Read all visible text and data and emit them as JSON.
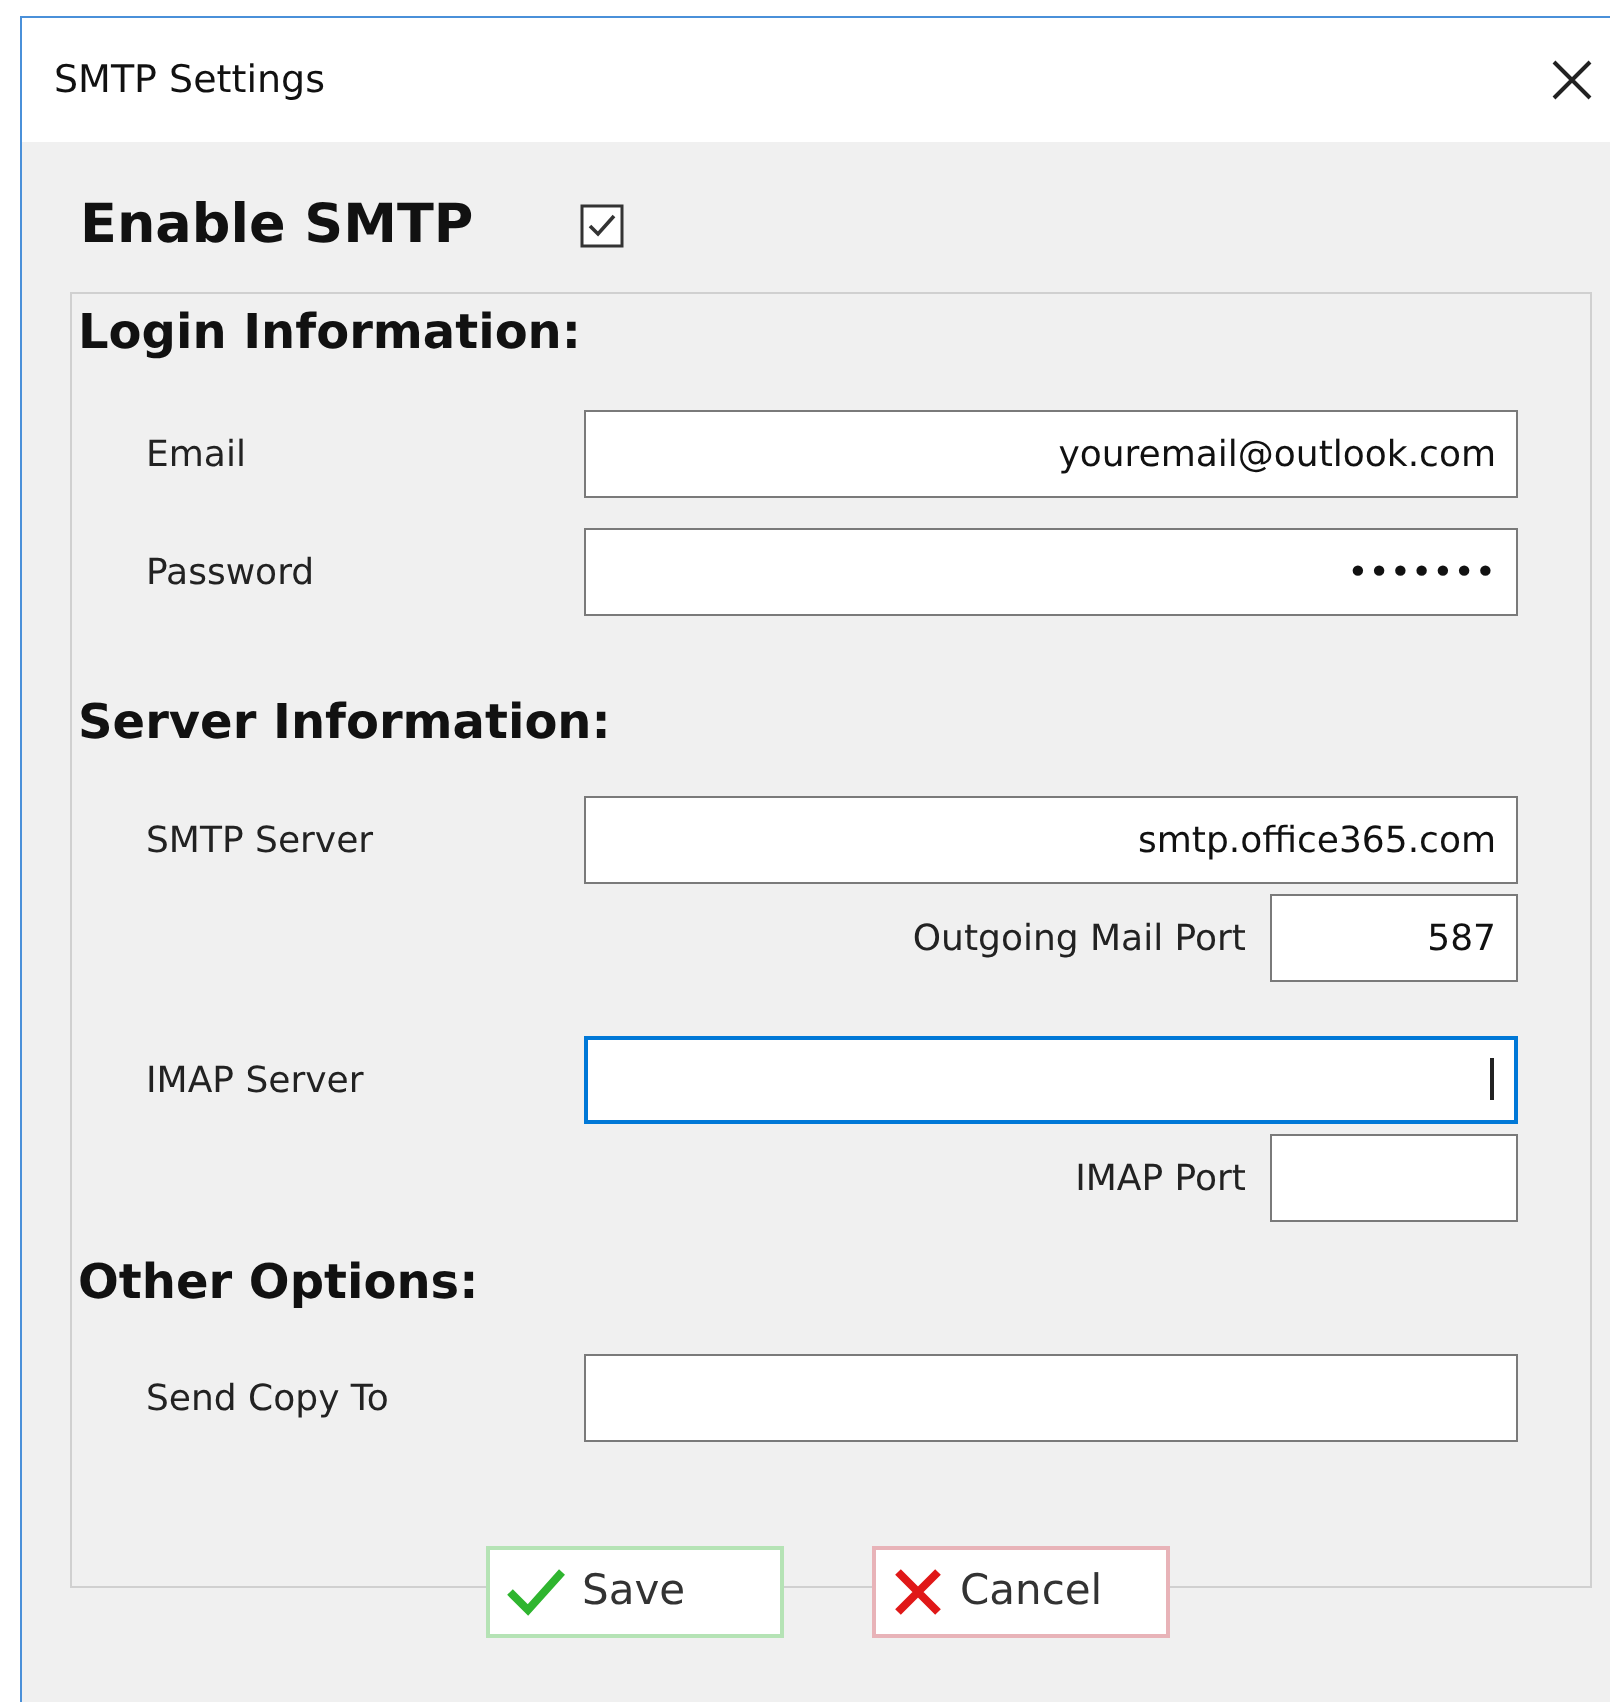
{
  "window": {
    "title": "SMTP Settings"
  },
  "enable_smtp": {
    "label": "Enable SMTP",
    "checked": true
  },
  "sections": [
    {
      "heading": "Login Information:",
      "fields": [
        {
          "kind": "row",
          "label": "Email",
          "value": "youremail@outlook.com",
          "focused": false
        },
        {
          "kind": "row",
          "label": "Password",
          "value": "•••••••",
          "focused": false
        }
      ]
    },
    {
      "heading": "Server Information:",
      "fields": [
        {
          "kind": "row",
          "label": "SMTP Server",
          "value": "smtp.office365.com",
          "focused": false
        },
        {
          "kind": "port",
          "label": "Outgoing Mail Port",
          "value": "587",
          "focused": false
        },
        {
          "kind": "row",
          "label": "IMAP Server",
          "focused": true
        },
        {
          "kind": "port",
          "label": "IMAP Port",
          "focused": false
        }
      ]
    },
    {
      "heading": "Other Options:",
      "fields": [
        {
          "kind": "row",
          "label": "Send Copy To",
          "focused": false
        }
      ]
    }
  ],
  "buttons": [
    {
      "kind": "save",
      "label": "Save"
    },
    {
      "kind": "cancel",
      "label": "Cancel"
    }
  ]
}
